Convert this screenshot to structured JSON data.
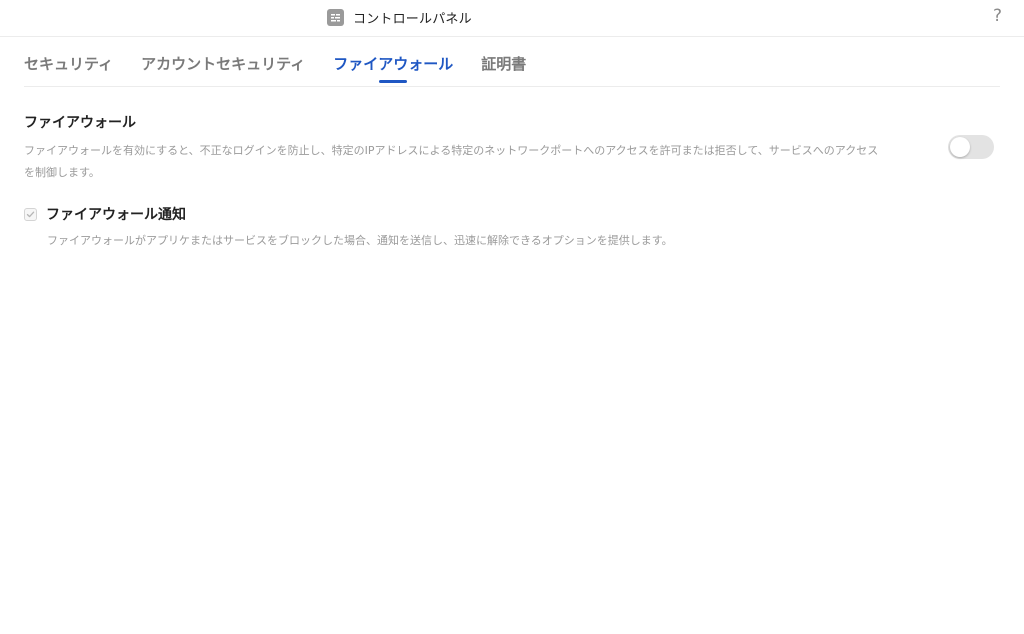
{
  "window": {
    "title": "コントロールパネル",
    "app_icon": "control-panel-icon",
    "help_label": "?"
  },
  "tabs": [
    {
      "label": "セキュリティ",
      "active": false
    },
    {
      "label": "アカウントセキュリティ",
      "active": false
    },
    {
      "label": "ファイアウォール",
      "active": true
    },
    {
      "label": "証明書",
      "active": false
    }
  ],
  "firewall": {
    "title": "ファイアウォール",
    "description": "ファイアウォールを有効にすると、不正なログインを防止し、特定のIPアドレスによる特定のネットワークポートへのアクセスを許可または拒否して、サービスへのアクセスを制御します。",
    "enabled": false
  },
  "notification": {
    "label": "ファイアウォール通知",
    "description": "ファイアウォールがアプリケまたはサービスをブロックした場合、通知を送信し、迅速に解除できるオプションを提供します。",
    "checked": true,
    "disabled": true
  },
  "colors": {
    "accent": "#1f57c3",
    "muted_text": "#9a9a9a",
    "tab_inactive": "#7a7a7a"
  }
}
